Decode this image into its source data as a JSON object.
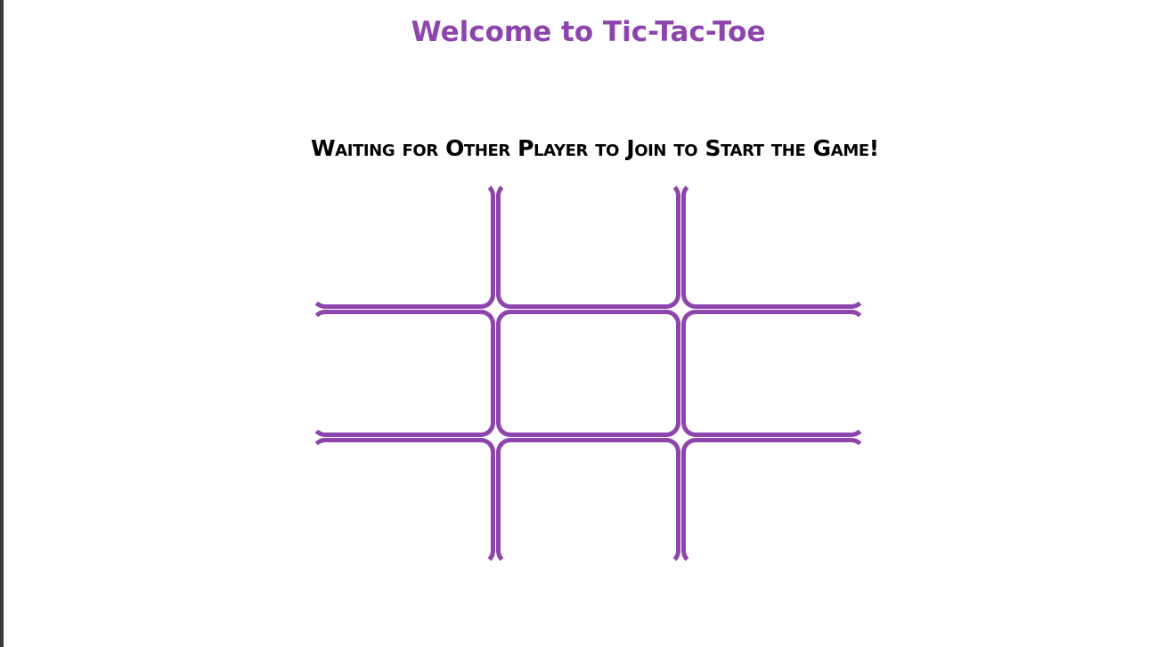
{
  "page": {
    "title": "Welcome to Tic-Tac-Toe",
    "status": "Waiting for Other Player to Join to Start the Game!"
  },
  "board": {
    "cells": [
      {
        "mark": ""
      },
      {
        "mark": ""
      },
      {
        "mark": ""
      },
      {
        "mark": ""
      },
      {
        "mark": ""
      },
      {
        "mark": ""
      },
      {
        "mark": ""
      },
      {
        "mark": ""
      },
      {
        "mark": ""
      }
    ]
  },
  "colors": {
    "accent": "#8e44ad",
    "text": "#000000",
    "background": "#ffffff"
  }
}
